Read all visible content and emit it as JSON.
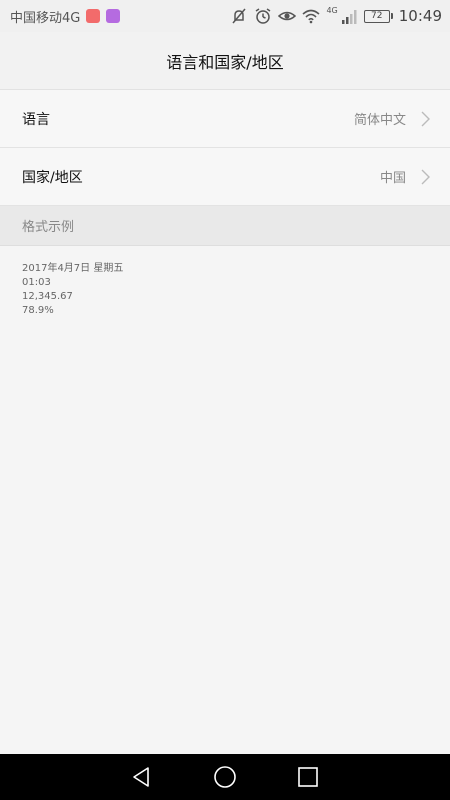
{
  "status_bar": {
    "carrier": "中国移动4G",
    "network_badge": "4G",
    "battery": "72",
    "time": "10:49",
    "icons": [
      "app-red-icon",
      "app-purple-icon",
      "mute-icon",
      "alarm-icon",
      "eye-icon",
      "wifi-icon",
      "signal-icon",
      "battery-icon"
    ],
    "colors": {
      "app_red": "#f26b6b",
      "app_purple": "#b56be0"
    }
  },
  "header": {
    "title": "语言和国家/地区"
  },
  "settings": {
    "rows": [
      {
        "label": "语言",
        "value": "简体中文"
      },
      {
        "label": "国家/地区",
        "value": "中国"
      }
    ]
  },
  "format_section": {
    "header": "格式示例",
    "examples": [
      "2017年4月7日 星期五",
      "01:03",
      "12,345.67",
      "78.9%"
    ]
  },
  "nav": {
    "icons": [
      "back-icon",
      "home-icon",
      "recents-icon"
    ]
  }
}
